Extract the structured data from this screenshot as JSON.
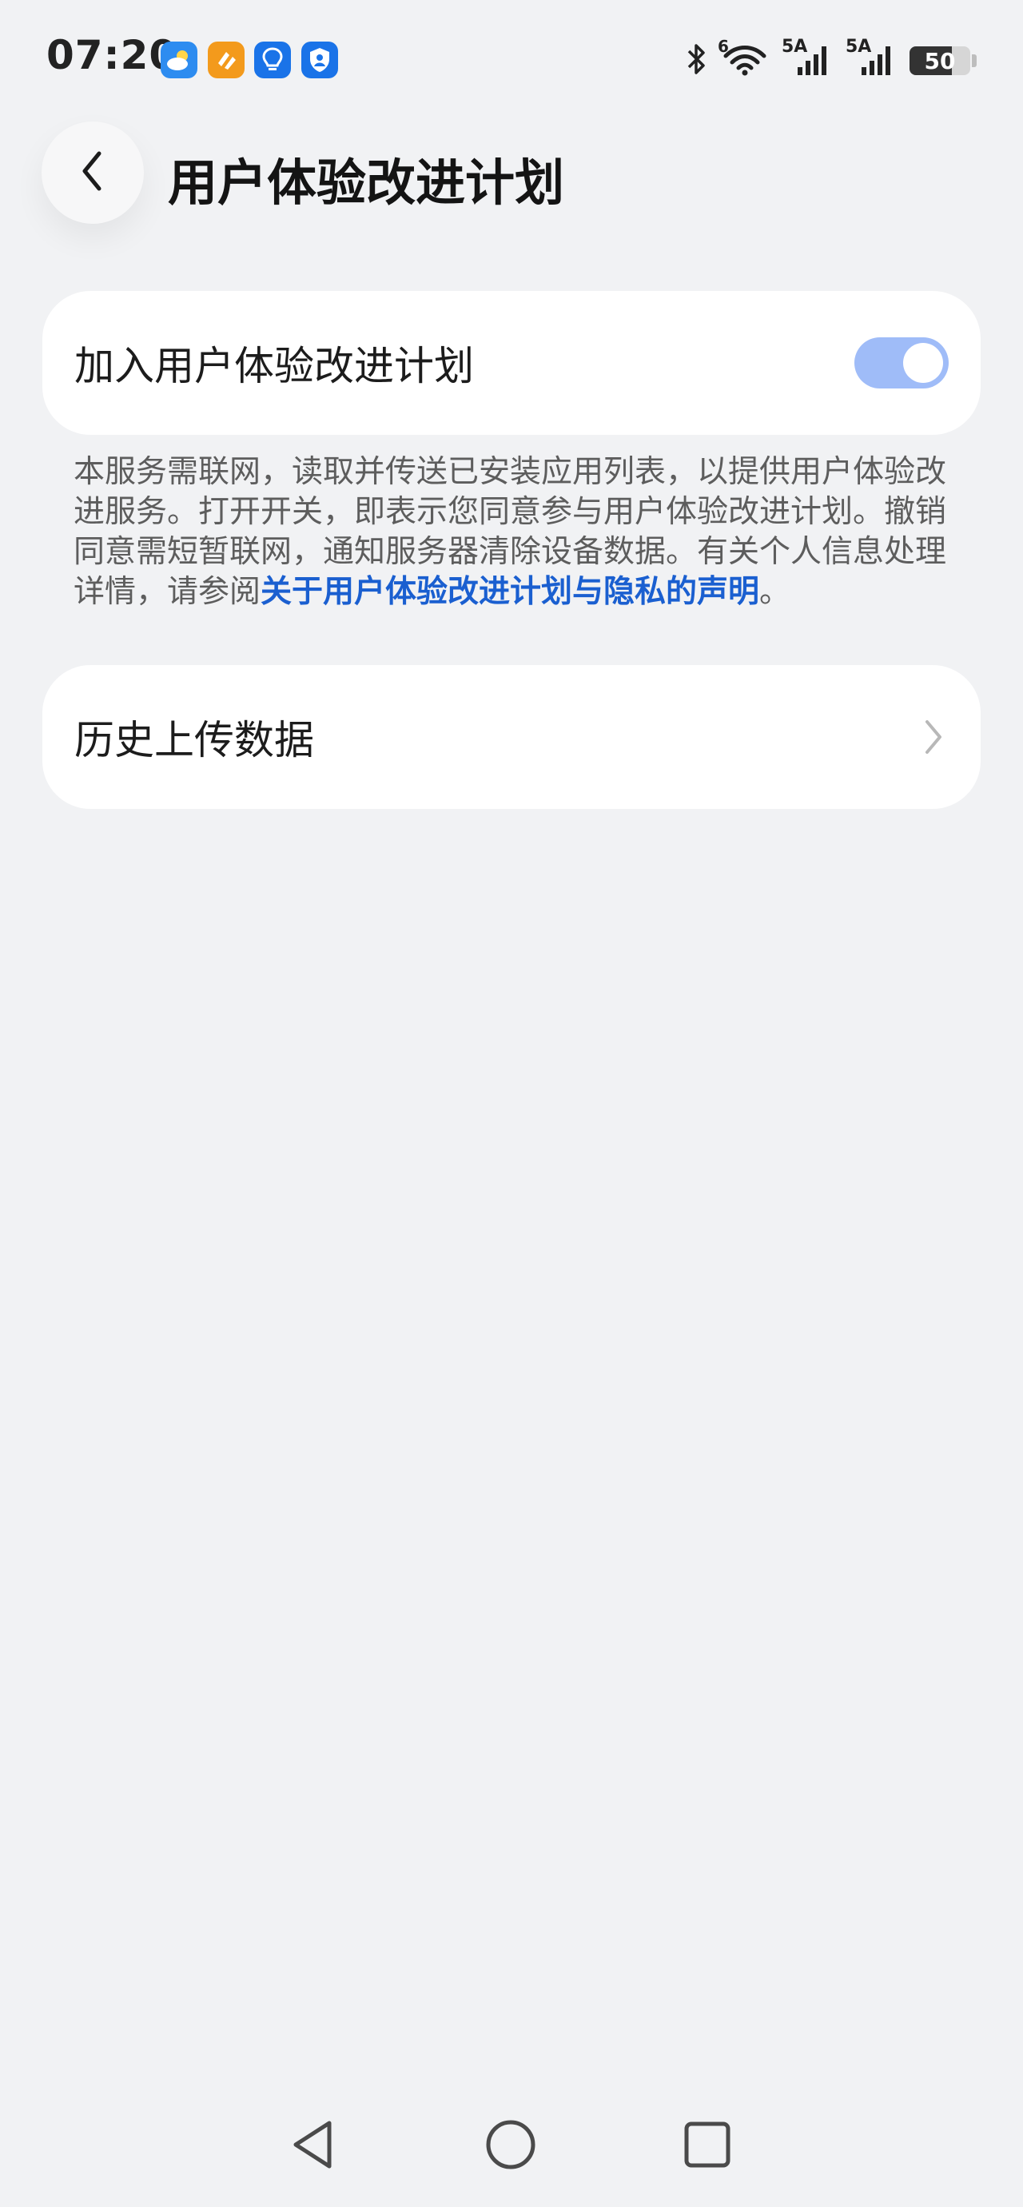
{
  "status_bar": {
    "time": "07:20",
    "battery_percent": "50",
    "signal_1_label": "5A",
    "signal_2_label": "5A",
    "wifi_label": "6",
    "app_icons": [
      "weather-icon",
      "orange-app-icon",
      "lightbulb-app-icon",
      "shield-app-icon"
    ]
  },
  "header": {
    "title": "用户体验改进计划",
    "back_icon": "chevron-left-icon"
  },
  "join_card": {
    "label": "加入用户体验改进计划",
    "toggle_on": true
  },
  "description": {
    "text": "本服务需联网，读取并传送已安装应用列表，以提供用户体验改进服务。打开开关，即表示您同意参与用户体验改进计划。撤销同意需短暂联网，通知服务器清除设备数据。有关个人信息处理详情，请参阅",
    "link_text": "关于用户体验改进计划与隐私的声明",
    "suffix": "。"
  },
  "history_card": {
    "label": "历史上传数据",
    "chevron_icon": "chevron-right-icon"
  },
  "colors": {
    "background": "#f1f2f4",
    "card": "#ffffff",
    "toggle_on": "#9fbcf8",
    "link": "#1a5fd0"
  },
  "nav_bar": {
    "back_icon": "triangle-back-icon",
    "home_icon": "circle-home-icon",
    "recent_icon": "square-recent-icon"
  }
}
